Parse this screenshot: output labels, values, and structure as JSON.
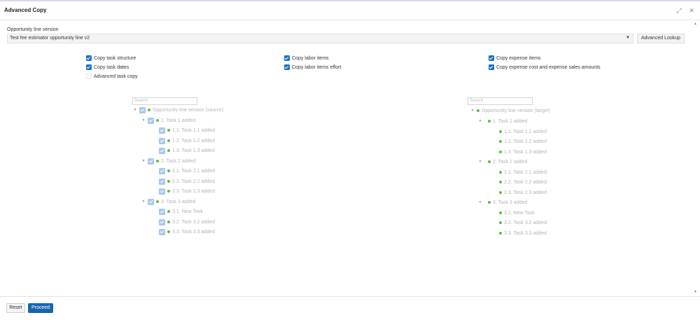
{
  "dialog": {
    "title": "Advanced Copy",
    "expand_icon": "expand-icon",
    "close_icon": "close-icon"
  },
  "version_field": {
    "label": "Opportunity line version",
    "value": "Test fee estimator opportunity line v2",
    "caret_icon": "caret-down-icon"
  },
  "advanced_lookup_label": "Advanced Lookup",
  "options": {
    "copy_task_structure": {
      "label": "Copy task structure",
      "checked": true
    },
    "copy_task_dates": {
      "label": "Copy task dates",
      "checked": true
    },
    "advanced_task_copy": {
      "label": "Advanced task copy",
      "checked": false
    },
    "copy_labor_items": {
      "label": "Copy labor items",
      "checked": true
    },
    "copy_labor_items_effort": {
      "label": "Copy labor items effort",
      "checked": true
    },
    "copy_expense_items": {
      "label": "Copy expense items",
      "checked": true
    },
    "copy_expense_amounts": {
      "label": "Copy expense cost and expense sales amounts",
      "checked": true
    }
  },
  "source_tree": {
    "search_placeholder": "Search",
    "root": "Opportunity line version (source)",
    "tasks": [
      {
        "label": "1. Task 1 added",
        "children": [
          "1.1. Task 1.1 added",
          "1.2. Task 1.2 added",
          "1.3. Task 1.3 added"
        ]
      },
      {
        "label": "2. Task 2 added",
        "children": [
          "2.1. Task 2.1 added",
          "2.2. Task 2.2 added",
          "2.3. Task 2.3 added"
        ]
      },
      {
        "label": "3. Task 3 added",
        "children": [
          "3.1. New Task",
          "3.2. Task 3.2 added",
          "3.3. Task 3.3 added"
        ]
      }
    ]
  },
  "target_tree": {
    "search_placeholder": "Search",
    "root": "Opportunity line version (target)",
    "tasks": [
      {
        "label": "1. Task 1 added",
        "children": [
          "1.1. Task 1.1 added",
          "1.2. Task 1.2 added",
          "1.3. Task 1.3 added"
        ]
      },
      {
        "label": "2. Task 2 added",
        "children": [
          "2.1. Task 2.1 added",
          "2.2. Task 2.2 added",
          "2.3. Task 2.3 added"
        ]
      },
      {
        "label": "3. Task 3 added",
        "children": [
          "3.1. New Task",
          "3.2. Task 3.2 added",
          "3.3. Task 3.3 added"
        ]
      }
    ]
  },
  "footer": {
    "reset_label": "Reset",
    "proceed_label": "Proceed"
  },
  "colors": {
    "primary": "#1866b0",
    "checkbox": "#1c6fbd",
    "tree_checkbox": "#a8c9ea",
    "node_dot": "#63b94a"
  }
}
